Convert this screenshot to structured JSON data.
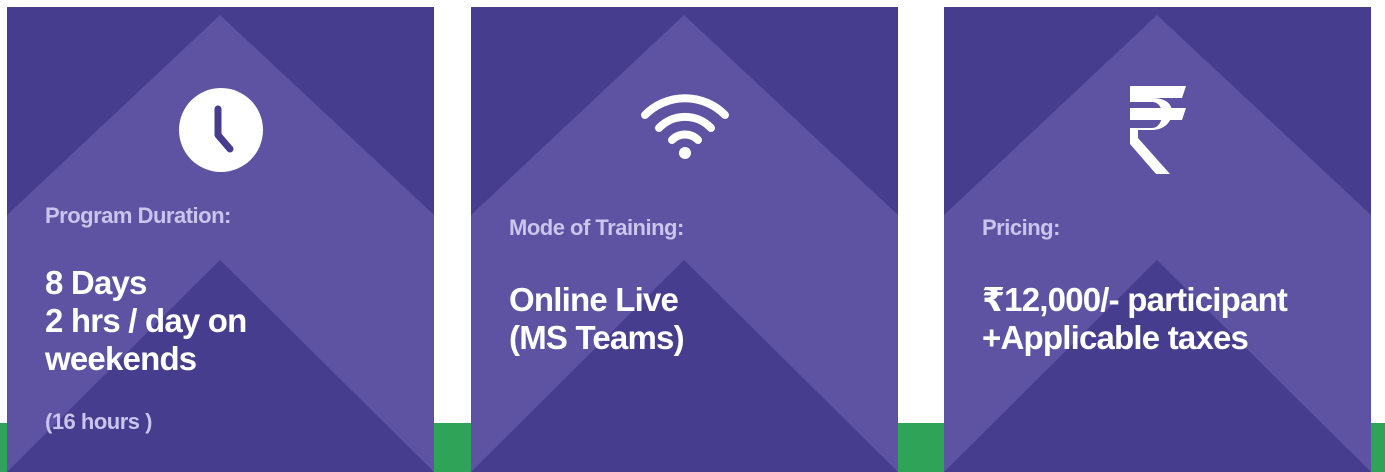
{
  "cards": [
    {
      "icon": "clock-icon",
      "label": "Program Duration:",
      "value_lines": [
        "8 Days",
        "2 hrs / day on",
        "weekends"
      ],
      "note": "(16 hours )"
    },
    {
      "icon": "wifi-icon",
      "label": "Mode of Training:",
      "value_lines": [
        "Online Live",
        "(MS Teams)"
      ]
    },
    {
      "icon": "rupee-icon",
      "label": "Pricing:",
      "value_lines": [
        "₹12,000/- participant",
        "+Applicable taxes"
      ]
    }
  ],
  "colors": {
    "card_background": "#473d8e",
    "card_chevron": "#5d53a2",
    "label_text": "#c9c5ec",
    "value_text": "#ffffff",
    "accent_band": "#2fa358"
  }
}
